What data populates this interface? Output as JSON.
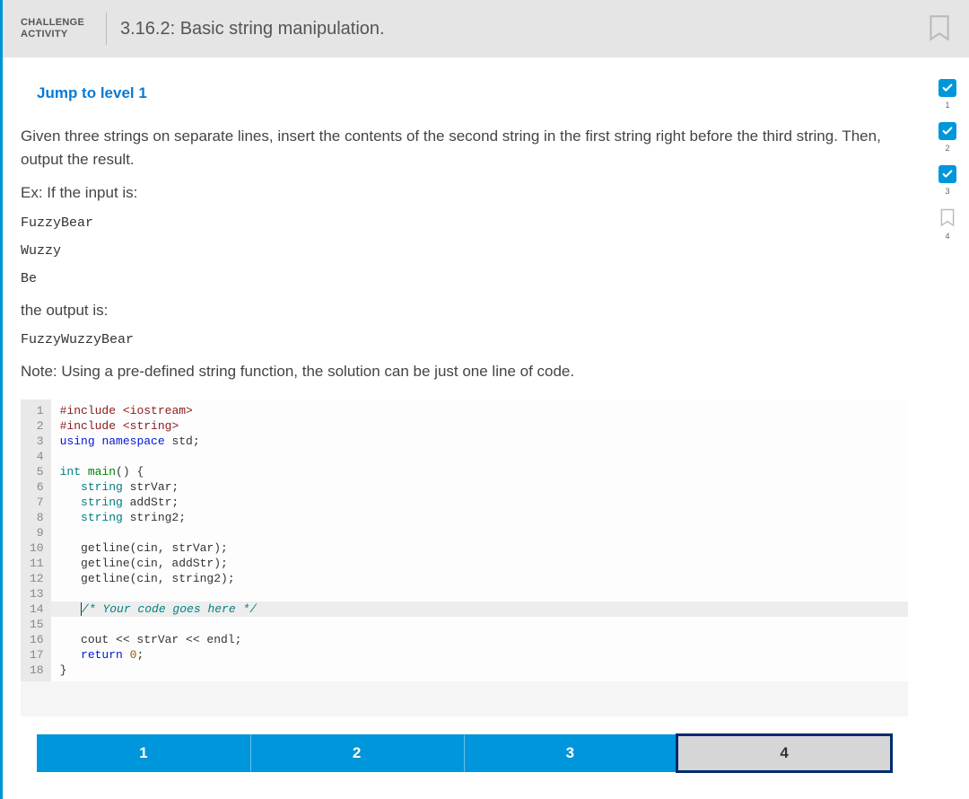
{
  "header": {
    "label_line1": "CHALLENGE",
    "label_line2": "ACTIVITY",
    "title": "3.16.2: Basic string manipulation."
  },
  "jump_link": "Jump to level 1",
  "prompt": {
    "p1": "Given three strings on separate lines, insert the contents of the second string in the first string right before the third string. Then, output the result.",
    "ex_label": "Ex: If the input is:",
    "in1": "FuzzyBear",
    "in2": "Wuzzy",
    "in3": "Be",
    "out_label": "the output is:",
    "out": "FuzzyWuzzyBear",
    "note": "Note: Using a pre-defined string function, the solution can be just one line of code."
  },
  "code": {
    "lines": [
      {
        "n": 1,
        "html": "<span class='kw-prep'>#include</span> <span class='kw-prep'>&lt;iostream&gt;</span>"
      },
      {
        "n": 2,
        "html": "<span class='kw-prep'>#include</span> <span class='kw-prep'>&lt;string&gt;</span>"
      },
      {
        "n": 3,
        "html": "<span class='kw-blue'>using</span> <span class='kw-blue'>namespace</span> std;"
      },
      {
        "n": 4,
        "html": ""
      },
      {
        "n": 5,
        "html": "<span class='kw-teal'>int</span> <span class='kw-green'>main</span>() {"
      },
      {
        "n": 6,
        "html": "   <span class='kw-teal'>string</span> strVar;"
      },
      {
        "n": 7,
        "html": "   <span class='kw-teal'>string</span> addStr;"
      },
      {
        "n": 8,
        "html": "   <span class='kw-teal'>string</span> string2;"
      },
      {
        "n": 9,
        "html": ""
      },
      {
        "n": 10,
        "html": "   getline(cin, strVar);"
      },
      {
        "n": 11,
        "html": "   getline(cin, addStr);"
      },
      {
        "n": 12,
        "html": "   getline(cin, string2);"
      },
      {
        "n": 13,
        "html": ""
      },
      {
        "n": 14,
        "html": "   <span class='cursor'></span><span class='kw-cmt'>/* Your code goes here */</span>",
        "hl": true
      },
      {
        "n": 15,
        "html": ""
      },
      {
        "n": 16,
        "html": "   cout &lt;&lt; strVar &lt;&lt; endl;"
      },
      {
        "n": 17,
        "html": "   <span class='kw-blue'>return</span> <span class='kw-num'>0</span>;"
      },
      {
        "n": 18,
        "html": "}"
      }
    ]
  },
  "progress": [
    {
      "n": "1",
      "done": true
    },
    {
      "n": "2",
      "done": true
    },
    {
      "n": "3",
      "done": true
    },
    {
      "n": "4",
      "done": false
    }
  ],
  "steps": [
    {
      "label": "1",
      "state": "active"
    },
    {
      "label": "2",
      "state": "active"
    },
    {
      "label": "3",
      "state": "active"
    },
    {
      "label": "4",
      "state": "current"
    }
  ]
}
